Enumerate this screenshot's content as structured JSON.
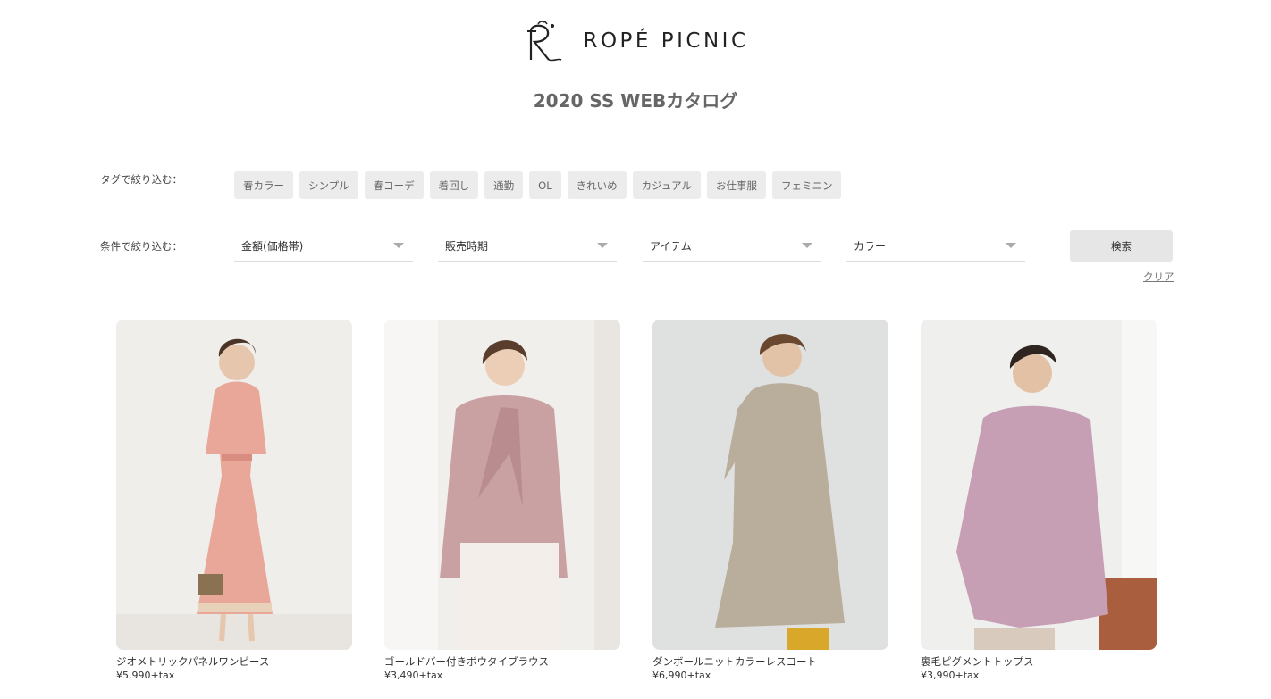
{
  "brand": {
    "name": "ROPÉ PICNIC",
    "logo_icon": "rope-picnic-monogram"
  },
  "catalog_title": "2020 SS WEBカタログ",
  "filters": {
    "tag_label": "タグで絞り込む：",
    "condition_label": "条件で絞り込む：",
    "tags": [
      "春カラー",
      "シンプル",
      "春コーデ",
      "着回し",
      "通勤",
      "OL",
      "きれいめ",
      "カジュアル",
      "お仕事服",
      "フェミニン"
    ],
    "selects": [
      {
        "value": "金額(価格帯)"
      },
      {
        "value": "販売時期"
      },
      {
        "value": "アイテム"
      },
      {
        "value": "カラー"
      }
    ],
    "search_label": "検索",
    "clear_label": "クリア"
  },
  "products": [
    {
      "name": "ジオメトリックパネルワンピース",
      "price": "¥5,990+tax",
      "color": "#e9a79a"
    },
    {
      "name": "ゴールドバー付きボウタイブラウス",
      "price": "¥3,490+tax",
      "color": "#c9a1a3"
    },
    {
      "name": "ダンボールニットカラーレスコート",
      "price": "¥6,990+tax",
      "color": "#b9ad9b"
    },
    {
      "name": "裏毛ピグメントトップス",
      "price": "¥3,990+tax",
      "color": "#c79fb5"
    }
  ]
}
